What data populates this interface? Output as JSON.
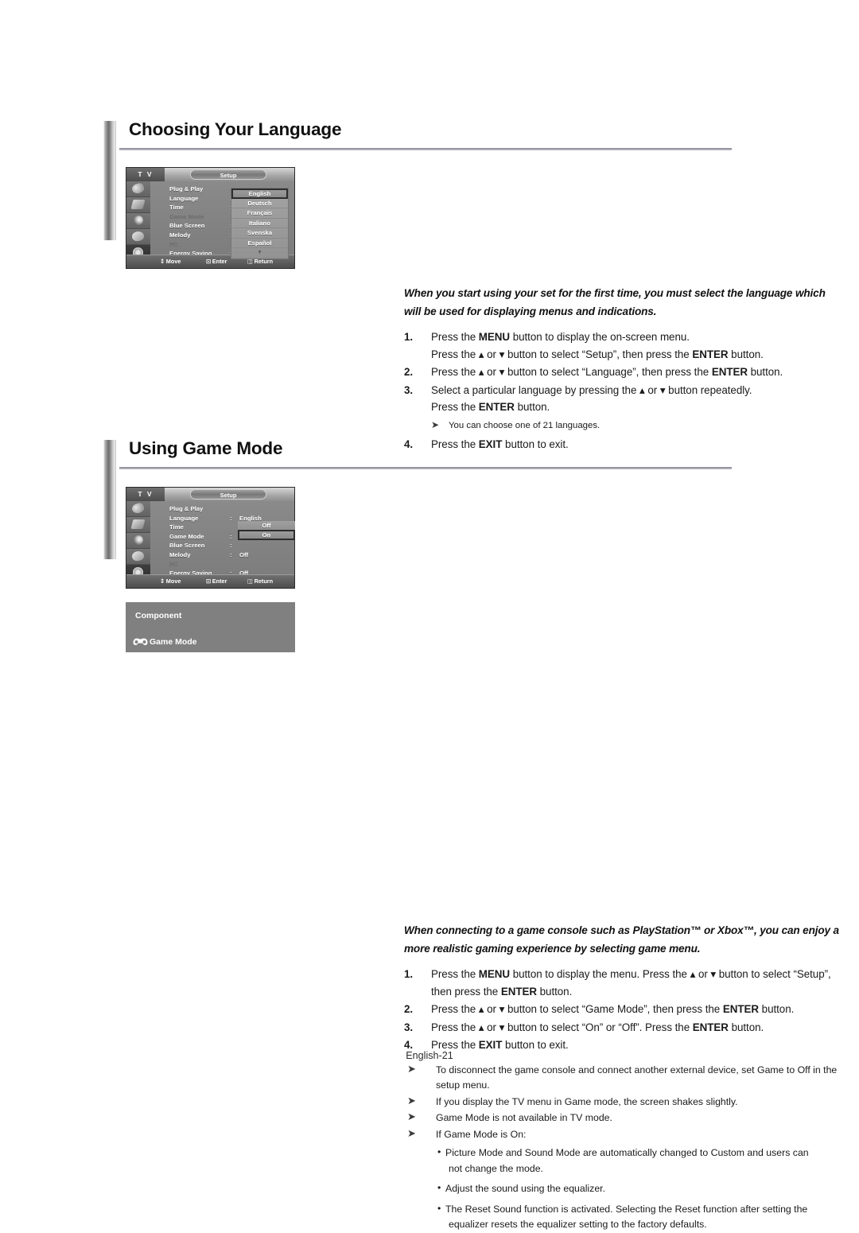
{
  "page": {
    "footer": "English-21"
  },
  "sections": [
    {
      "title": "Choosing Your Language",
      "lead": "When you start using your set for the first time, you must select the language which will be used for displaying menus and indications.",
      "steps": [
        {
          "num": "1.",
          "html": "Press the <b>MENU</b> button to display the on-screen menu.<br>Press the ▴ or ▾ button to select “Setup”, then press the <b>ENTER</b> button."
        },
        {
          "num": "2.",
          "html": "Press the ▴ or ▾ button to select “Language”, then press the <b>ENTER</b> button."
        },
        {
          "num": "3.",
          "html": "Select a particular language by pressing the ▴ or ▾ button repeatedly.<br>Press the <b>ENTER</b> button."
        },
        {
          "num": "4.",
          "html": "Press the <b>EXIT</b> button to exit."
        }
      ],
      "substep_note": "You can choose one of 21 languages."
    },
    {
      "title": "Using Game Mode",
      "lead": "When connecting to a game console such as PlayStation™ or Xbox™, you can enjoy a more realistic gaming experience by selecting game menu.",
      "steps": [
        {
          "num": "1.",
          "html": "Press the <b>MENU</b> button to display the menu. Press the ▴ or ▾ button to select “Setup”, then press the <b>ENTER</b> button."
        },
        {
          "num": "2.",
          "html": "Press the ▴ or ▾ button to select “Game Mode”, then press the <b>ENTER</b> button."
        },
        {
          "num": "3.",
          "html": "Press the ▴ or ▾ button to select “On” or “Off”. Press the <b>ENTER</b> button."
        },
        {
          "num": "4.",
          "html": "Press the <b>EXIT</b> button to exit."
        }
      ],
      "notes": [
        "To disconnect the game console and connect another external device, set Game to Off in the setup menu.",
        "If you display the TV menu in Game mode, the screen shakes slightly.",
        "Game Mode is not available in TV mode.",
        "If Game Mode is On:"
      ],
      "subbullets": [
        "Picture Mode and Sound Mode are automatically changed to Custom and users can",
        "not change the mode.",
        "Adjust the sound using the equalizer.",
        "The Reset Sound function is activated. Selecting the Reset function after setting the",
        "equalizer resets the equalizer setting to the factory defaults."
      ]
    }
  ],
  "osd_menu_1": {
    "device_label": "T V",
    "tab_label": "Setup",
    "rows": [
      {
        "label": "Plug & Play",
        "colon": "",
        "value": "",
        "dim": false
      },
      {
        "label": "Language",
        "colon": ":",
        "value": "",
        "dim": false
      },
      {
        "label": "Time",
        "colon": ":",
        "value": "",
        "dim": false
      },
      {
        "label": "Game Mode",
        "colon": ":",
        "value": "",
        "dim": true
      },
      {
        "label": "Blue Screen",
        "colon": ":",
        "value": "",
        "dim": false
      },
      {
        "label": "Melody",
        "colon": ":",
        "value": "",
        "dim": false
      },
      {
        "label": "PC",
        "colon": "",
        "value": "",
        "dim": true
      },
      {
        "label": "Energy Saving",
        "colon": ":",
        "value": "",
        "dim": false
      }
    ],
    "language_options": [
      "English",
      "Deutsch",
      "Français",
      "Italiano",
      "Svenska",
      "Español"
    ],
    "language_selected": "English",
    "language_more": "▾",
    "bottom_bar": [
      {
        "glyph": "⬍",
        "label": "Move"
      },
      {
        "glyph": "⮕",
        "label": "Enter"
      },
      {
        "glyph": "☰",
        "label": "Return"
      }
    ]
  },
  "osd_menu_2": {
    "device_label": "T V",
    "tab_label": "Setup",
    "rows": [
      {
        "label": "Plug & Play",
        "colon": "",
        "value": "",
        "dim": false
      },
      {
        "label": "Language",
        "colon": ":",
        "value": "English",
        "dim": false
      },
      {
        "label": "Time",
        "colon": "",
        "value": "",
        "dim": false
      },
      {
        "label": "Game Mode",
        "colon": ":",
        "value": "",
        "dim": false
      },
      {
        "label": "Blue Screen",
        "colon": ":",
        "value": "",
        "dim": false
      },
      {
        "label": "Melody",
        "colon": ":",
        "value": "Off",
        "dim": false
      },
      {
        "label": "PC",
        "colon": "",
        "value": "",
        "dim": true
      },
      {
        "label": "Energy Saving",
        "colon": ":",
        "value": "Off",
        "dim": false
      }
    ],
    "onoff_options": [
      "Off",
      "On"
    ],
    "onoff_selected": "On",
    "bottom_bar": [
      {
        "glyph": "⬍",
        "label": "Move"
      },
      {
        "glyph": "⮕",
        "label": "Enter"
      },
      {
        "glyph": "☰",
        "label": "Return"
      }
    ]
  },
  "component_box": {
    "title": "Component",
    "game_mode_label": "Game Mode",
    "icon": "gamepad-icon"
  },
  "colors": {
    "heading_text": "#111111",
    "rule": "#9a9aa4",
    "osd_body": "#828282",
    "component_bg": "#808080"
  }
}
